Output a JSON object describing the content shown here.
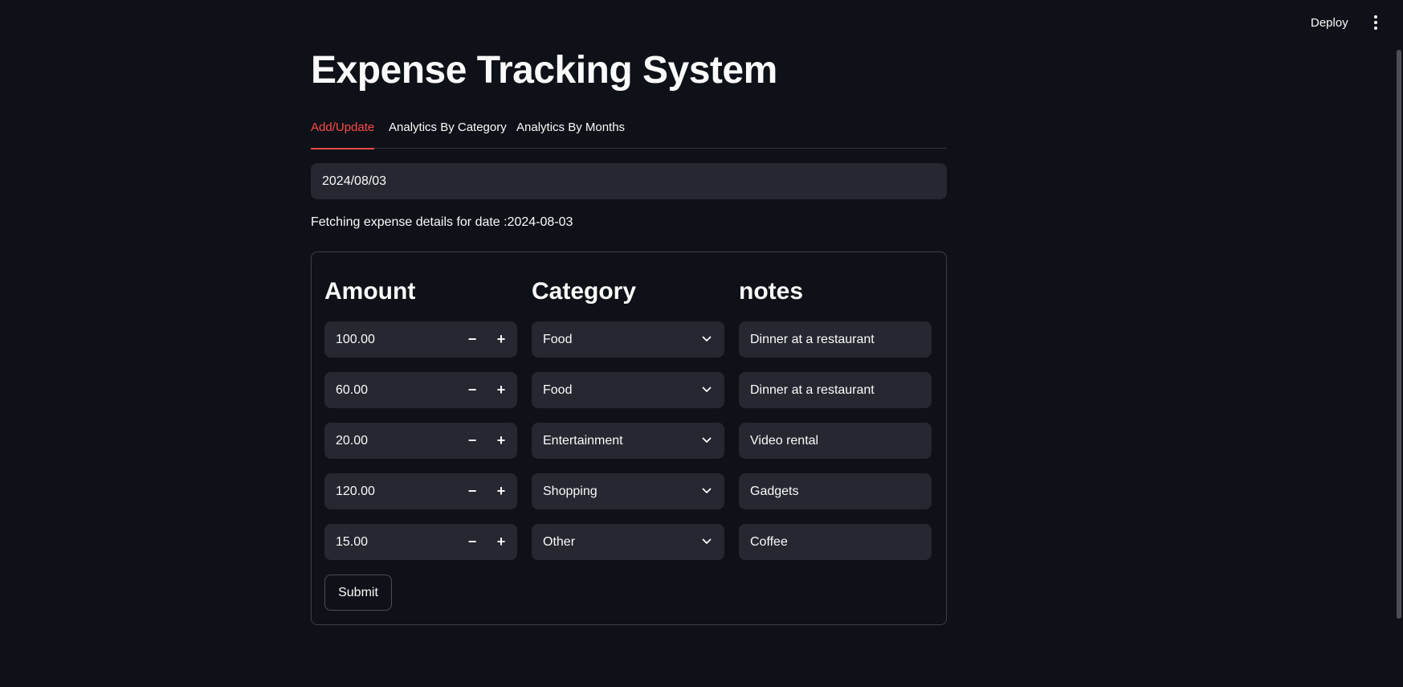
{
  "header": {
    "deploy_label": "Deploy",
    "menu_icon": "kebab-menu-icon"
  },
  "page": {
    "title": "Expense Tracking System",
    "tabs": [
      {
        "label": "Add/Update",
        "active": true
      },
      {
        "label": "Analytics By Category",
        "active": false
      },
      {
        "label": "Analytics By Months",
        "active": false
      }
    ],
    "date_value": "2024/08/03",
    "fetch_message": "Fetching expense details for date :2024-08-03"
  },
  "form": {
    "headers": {
      "amount": "Amount",
      "category": "Category",
      "notes": "notes"
    },
    "rows": [
      {
        "amount": "100.00",
        "category": "Food",
        "notes": "Dinner at a restaurant"
      },
      {
        "amount": "60.00",
        "category": "Food",
        "notes": "Dinner at a restaurant"
      },
      {
        "amount": "20.00",
        "category": "Entertainment",
        "notes": "Video rental"
      },
      {
        "amount": "120.00",
        "category": "Shopping",
        "notes": "Gadgets"
      },
      {
        "amount": "15.00",
        "category": "Other",
        "notes": "Coffee"
      }
    ],
    "stepper": {
      "minus": "−",
      "plus": "+"
    },
    "submit_label": "Submit"
  },
  "colors": {
    "background": "#0e1117",
    "input_bg": "#262730",
    "accent": "#ff4b4b",
    "text": "#fafafa"
  }
}
